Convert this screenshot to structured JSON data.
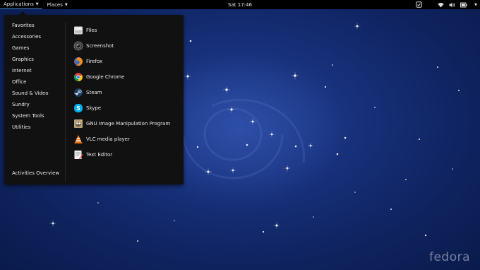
{
  "topbar": {
    "applications_label": "Applications",
    "places_label": "Places",
    "clock": "Sat 17:46"
  },
  "menu": {
    "categories": [
      "Favorites",
      "Accessories",
      "Games",
      "Graphics",
      "Internet",
      "Office",
      "Sound & Video",
      "Sundry",
      "System Tools",
      "Utilities"
    ],
    "activities_label": "Activities Overview",
    "apps": [
      {
        "label": "Files",
        "icon": "files-icon"
      },
      {
        "label": "Screenshot",
        "icon": "screenshot-icon"
      },
      {
        "label": "Firefox",
        "icon": "firefox-icon"
      },
      {
        "label": "Google Chrome",
        "icon": "chrome-icon"
      },
      {
        "label": "Steam",
        "icon": "steam-icon"
      },
      {
        "label": "Skype",
        "icon": "skype-icon"
      },
      {
        "label": "GNU Image Manipulation Program",
        "icon": "gimp-icon"
      },
      {
        "label": "VLC media player",
        "icon": "vlc-icon"
      },
      {
        "label": "Text Editor",
        "icon": "text-editor-icon"
      }
    ]
  },
  "wallpaper": {
    "logo_text": "fedora"
  },
  "colors": {
    "accent": "#4a90d9",
    "topbar": "#000000",
    "menu": "#111111",
    "wallpaper": "#17307a"
  }
}
